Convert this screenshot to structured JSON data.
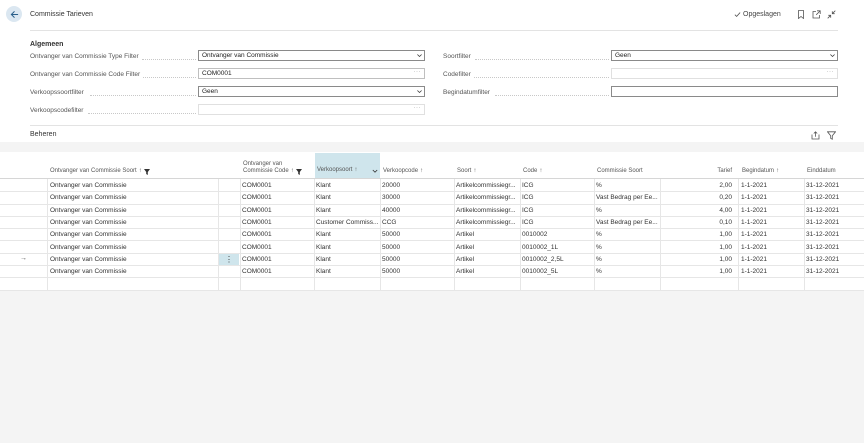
{
  "header": {
    "title": "Commissie Tarieven",
    "saved_label": "Opgeslagen",
    "saved_icon": "check-icon"
  },
  "filters": {
    "group_title": "Algemeen",
    "type_filter_label": "Ontvanger van Commissie Type Filter",
    "type_filter_value": "Ontvanger van Commissie",
    "code_filter_label": "Ontvanger van Commissie Code Filter",
    "code_filter_value": "COM0001",
    "verkoopssoort_label": "Verkoopssoortfilter",
    "verkoopssoort_value": "Geen",
    "verkoopscode_label": "Verkoopscodefilter",
    "verkoopscode_value": "",
    "soort_label": "Soortfilter",
    "soort_value": "Geen",
    "code_label": "Codefilter",
    "code_value": "",
    "begindatum_label": "Begindatumfilter",
    "begindatum_value": ""
  },
  "section": {
    "title": "Beheren"
  },
  "table": {
    "columns": {
      "ontvanger_soort": "Ontvanger van Commissie Soort",
      "ontvanger_code_line1": "Ontvanger van",
      "ontvanger_code_line2": "Commissie Code",
      "verkoopsoort": "Verkoopsoort",
      "verkoopcode": "Verkoopcode",
      "soort": "Soort",
      "code": "Code",
      "commissie_soort": "Commissie Soort",
      "tarief": "Tarief",
      "begindatum": "Begindatum",
      "einddatum": "Einddatum"
    },
    "sort_glyph": "↑",
    "rows": [
      {
        "ontvanger_soort": "Ontvanger van Commissie",
        "ontvanger_code": "COM0001",
        "verkoopsoort": "Klant",
        "verkoopcode": "20000",
        "soort": "Artikelcommissiegr...",
        "code": "ICG",
        "commissie_soort": "%",
        "tarief": "2,00",
        "begindatum": "1-1-2021",
        "einddatum": "31-12-2021"
      },
      {
        "ontvanger_soort": "Ontvanger van Commissie",
        "ontvanger_code": "COM0001",
        "verkoopsoort": "Klant",
        "verkoopcode": "30000",
        "soort": "Artikelcommissiegr...",
        "code": "ICG",
        "commissie_soort": "Vast Bedrag per Ee...",
        "tarief": "0,20",
        "begindatum": "1-1-2021",
        "einddatum": "31-12-2021"
      },
      {
        "ontvanger_soort": "Ontvanger van Commissie",
        "ontvanger_code": "COM0001",
        "verkoopsoort": "Klant",
        "verkoopcode": "40000",
        "soort": "Artikelcommissiegr...",
        "code": "ICG",
        "commissie_soort": "%",
        "tarief": "4,00",
        "begindatum": "1-1-2021",
        "einddatum": "31-12-2021"
      },
      {
        "ontvanger_soort": "Ontvanger van Commissie",
        "ontvanger_code": "COM0001",
        "verkoopsoort": "Customer Commiss...",
        "verkoopcode": "CCG",
        "soort": "Artikelcommissiegr...",
        "code": "ICG",
        "commissie_soort": "Vast Bedrag per Ee...",
        "tarief": "0,10",
        "begindatum": "1-1-2021",
        "einddatum": "31-12-2021"
      },
      {
        "ontvanger_soort": "Ontvanger van Commissie",
        "ontvanger_code": "COM0001",
        "verkoopsoort": "Klant",
        "verkoopcode": "50000",
        "soort": "Artikel",
        "code": "0010002",
        "commissie_soort": "%",
        "tarief": "1,00",
        "begindatum": "1-1-2021",
        "einddatum": "31-12-2021"
      },
      {
        "ontvanger_soort": "Ontvanger van Commissie",
        "ontvanger_code": "COM0001",
        "verkoopsoort": "Klant",
        "verkoopcode": "50000",
        "soort": "Artikel",
        "code": "0010002_1L",
        "commissie_soort": "%",
        "tarief": "1,00",
        "begindatum": "1-1-2021",
        "einddatum": "31-12-2021"
      },
      {
        "ontvanger_soort": "Ontvanger van Commissie",
        "ontvanger_code": "COM0001",
        "verkoopsoort": "Klant",
        "verkoopcode": "50000",
        "soort": "Artikel",
        "code": "0010002_2,5L",
        "commissie_soort": "%",
        "tarief": "1,00",
        "begindatum": "1-1-2021",
        "einddatum": "31-12-2021"
      },
      {
        "ontvanger_soort": "Ontvanger van Commissie",
        "ontvanger_code": "COM0001",
        "verkoopsoort": "Klant",
        "verkoopcode": "50000",
        "soort": "Artikel",
        "code": "0010002_5L",
        "commissie_soort": "%",
        "tarief": "1,00",
        "begindatum": "1-1-2021",
        "einddatum": "31-12-2021"
      }
    ],
    "current_row_indicator": "→",
    "row_menu_glyph": "⋮"
  },
  "colors": {
    "accent": "#cfe5ec",
    "back_button_bg": "#dbe7f1",
    "page_bg": "#f4f4f4"
  }
}
